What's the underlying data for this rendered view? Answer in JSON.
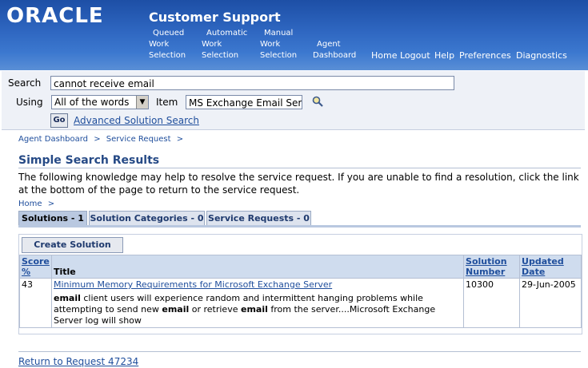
{
  "header": {
    "logo": "ORACLE",
    "title": "Customer Support",
    "nav_multi": [
      {
        "lines": [
          "Queued",
          "Work",
          "Selection"
        ]
      },
      {
        "lines": [
          "Automatic",
          "Work",
          "Selection"
        ]
      },
      {
        "lines": [
          "Manual",
          "Work",
          "Selection"
        ]
      },
      {
        "lines": [
          "Agent",
          "Dashboard"
        ]
      }
    ],
    "nav_top": [
      "Home",
      "Logout",
      "Help",
      "Preferences",
      "Diagnostics"
    ]
  },
  "search": {
    "search_label": "Search",
    "search_value": "cannot receive email",
    "using_label": "Using",
    "using_value": "All of the words",
    "item_label": "Item",
    "item_value": "MS Exchange Email Serv",
    "go_label": "Go",
    "advanced_link": "Advanced Solution Search"
  },
  "breadcrumb": {
    "items": [
      "Agent Dashboard",
      "Service Request"
    ],
    "separator": ">"
  },
  "page": {
    "title": "Simple Search Results",
    "description": "The following knowledge may help to resolve the service request. If you are unable to find a resolution, click the link at the bottom of the page to return to the service request.",
    "home_crumb": "Home",
    "home_sep": ">"
  },
  "tabs": [
    {
      "label": "Solutions - 1",
      "active": true
    },
    {
      "label": "Solution Categories - 0",
      "active": false
    },
    {
      "label": "Service Requests - 0",
      "active": false
    }
  ],
  "results": {
    "create_button": "Create Solution",
    "columns": {
      "score_line1": "Score",
      "score_line2": "%",
      "title": "Title",
      "number_line1": "Solution",
      "number_line2": "Number",
      "date_line1": "Updated",
      "date_line2": "Date"
    },
    "rows": [
      {
        "score": "43",
        "title": "Minimum Memory Requirements for Microsoft Exchange Server",
        "snippet_parts": [
          {
            "text": "email",
            "bold": true
          },
          {
            "text": " client users will experience random and intermittent hanging problems while attempting to send new ",
            "bold": false
          },
          {
            "text": "email",
            "bold": true
          },
          {
            "text": " or retrieve ",
            "bold": false
          },
          {
            "text": "email",
            "bold": true
          },
          {
            "text": " from the server....Microsoft Exchange Server log will show",
            "bold": false
          }
        ],
        "number": "10300",
        "date": "29-Jun-2005"
      }
    ]
  },
  "footer": {
    "return_link": "Return to Request 47234"
  },
  "colors": {
    "header_blue": "#2f67c1",
    "link_blue": "#1f4e9c",
    "tab_active": "#b9c8e0",
    "table_header": "#cfdcee"
  }
}
